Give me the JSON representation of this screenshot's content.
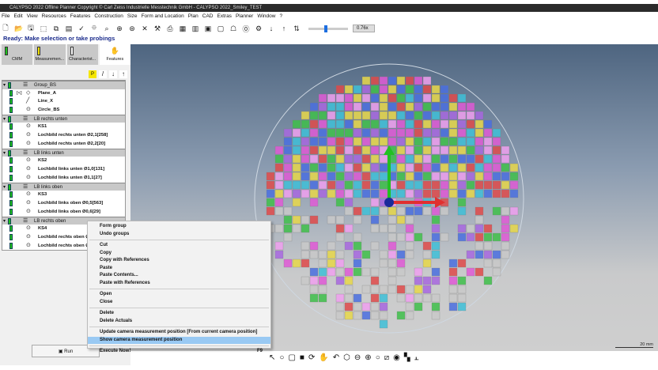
{
  "window": {
    "title": "CALYPSO 2022 Offline Planner Copyright © Carl Zeiss Industrielle Messtechnik GmbH - CALYPSO 2022_Smiley_TEST"
  },
  "menu": [
    "File",
    "Edit",
    "View",
    "Resources",
    "Features",
    "Construction",
    "Size",
    "Form and Location",
    "Plan",
    "CAD",
    "Extras",
    "Planner",
    "Window",
    "?"
  ],
  "toolbar": {
    "zoom_value": "0.76x",
    "zoom_fraction": 0.4
  },
  "status": "Ready: Make selection or take probings",
  "tabs": [
    {
      "label": "CMM",
      "color": "#1fbf1f"
    },
    {
      "label": "Measuremen...",
      "color": "#f0e000"
    },
    {
      "label": "Characterist...",
      "color": "#ffffff"
    },
    {
      "label": "Features",
      "color": ""
    }
  ],
  "tree": [
    {
      "group": "Group_BS",
      "items": [
        {
          "label": "Plane_A",
          "icon": "plane",
          "prefix": "[<]"
        },
        {
          "label": "Line_X",
          "icon": "line"
        },
        {
          "label": "Circle_BS",
          "icon": "circle"
        }
      ]
    },
    {
      "group": "LB rechts unten",
      "items": [
        {
          "label": "KS1",
          "icon": "circle"
        },
        {
          "label": "Lochbild rechts unten Ø2,1[258]",
          "icon": "circle"
        },
        {
          "label": "Lochbild rechts unten Ø2,2[20]",
          "icon": "circle"
        }
      ]
    },
    {
      "group": "LB links unten",
      "items": [
        {
          "label": "KS2",
          "icon": "circle"
        },
        {
          "label": "Lochbild links unten Ø1,0[131]",
          "icon": "circle"
        },
        {
          "label": "Lochbild links unten Ø1,1[27]",
          "icon": "circle"
        }
      ]
    },
    {
      "group": "LB links oben",
      "items": [
        {
          "label": "KS3",
          "icon": "circle"
        },
        {
          "label": "Lochbild links oben Ø0,5[563]",
          "icon": "circle"
        },
        {
          "label": "Lochbild links oben Ø0,6[29]",
          "icon": "circle"
        }
      ]
    },
    {
      "group": "LB rechts oben",
      "items": [
        {
          "label": "KS4",
          "icon": "circle"
        },
        {
          "label": "Lochbild rechts oben Ø",
          "icon": "circle"
        },
        {
          "label": "Lochbild rechts oben Ø",
          "icon": "circle"
        }
      ]
    }
  ],
  "run_button": "Run",
  "context_menu": [
    [
      {
        "label": "Form group"
      },
      {
        "label": "Undo groups"
      }
    ],
    [
      {
        "label": "Cut"
      },
      {
        "label": "Copy"
      },
      {
        "label": "Copy with References"
      },
      {
        "label": "Paste"
      },
      {
        "label": "Paste Contents..."
      },
      {
        "label": "Paste with References"
      }
    ],
    [
      {
        "label": "Open"
      },
      {
        "label": "Close"
      }
    ],
    [
      {
        "label": "Delete"
      },
      {
        "label": "Delete Actuals"
      }
    ],
    [
      {
        "label": "Update camera measurement position  [From current camera position]"
      },
      {
        "label": "Show camera measurement position",
        "highlighted": true
      }
    ],
    [
      {
        "label": "Execute Now!",
        "shortcut": "F9"
      }
    ]
  ],
  "view": {
    "scale_label": "20 mm"
  }
}
